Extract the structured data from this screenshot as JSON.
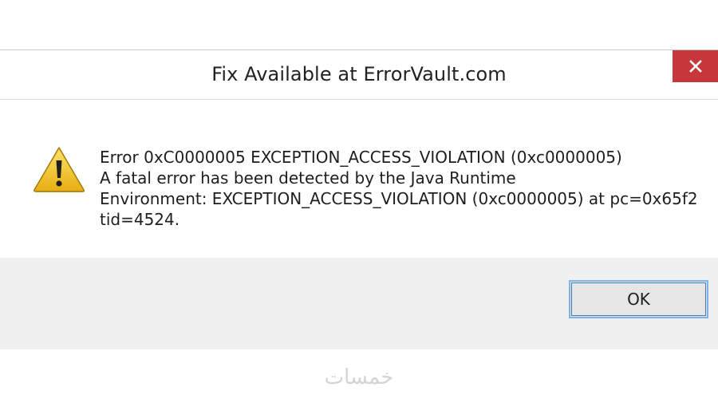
{
  "dialog": {
    "title": "Fix Available at ErrorVault.com",
    "close_icon": "close-icon",
    "icon": "warning-icon",
    "message_lines": [
      "Error 0xC0000005 EXCEPTION_ACCESS_VIOLATION (0xc0000005)",
      "A fatal error has been detected by the Java Runtime",
      "Environment: EXCEPTION_ACCESS_VIOLATION (0xc0000005) at pc=0x65f2",
      "tid=4524."
    ],
    "ok_label": "OK"
  },
  "watermark": "خمسات",
  "colors": {
    "close_bg": "#c7373a",
    "footer_bg": "#f0f0f0",
    "ok_border": "#7fb2e6",
    "warning_fill": "#f2c230"
  }
}
